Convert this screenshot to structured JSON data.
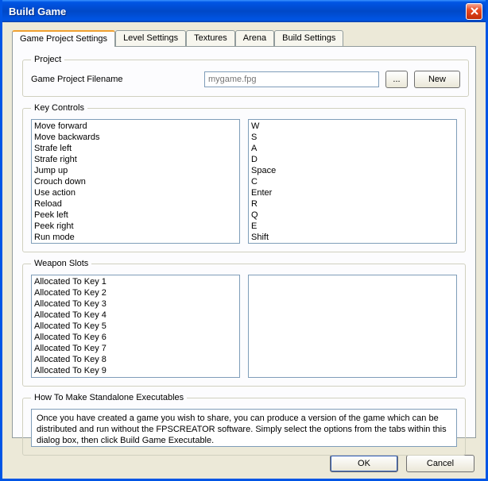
{
  "window": {
    "title": "Build Game"
  },
  "tabs": [
    {
      "label": "Game Project Settings"
    },
    {
      "label": "Level Settings"
    },
    {
      "label": "Textures"
    },
    {
      "label": "Arena"
    },
    {
      "label": "Build Settings"
    }
  ],
  "project": {
    "legend": "Project",
    "label": "Game Project Filename",
    "placeholder": "mygame.fpg",
    "browse": "...",
    "new": "New"
  },
  "key_controls": {
    "legend": "Key Controls",
    "actions": [
      "Move forward",
      "Move backwards",
      "Strafe left",
      "Strafe right",
      "Jump up",
      "Crouch down",
      "Use action",
      "Reload",
      "Peek left",
      "Peek right",
      "Run mode"
    ],
    "keys": [
      "W",
      "S",
      "A",
      "D",
      "Space",
      "C",
      "Enter",
      "R",
      "Q",
      "E",
      "Shift"
    ]
  },
  "weapon_slots": {
    "legend": "Weapon Slots",
    "slots": [
      "Allocated To Key 1",
      "Allocated To Key 2",
      "Allocated To Key 3",
      "Allocated To Key 4",
      "Allocated To Key 5",
      "Allocated To Key 6",
      "Allocated To Key 7",
      "Allocated To Key 8",
      "Allocated To Key 9"
    ]
  },
  "howto": {
    "legend": "How To Make Standalone Executables",
    "text": "Once you have created a game you wish to share, you can produce a version of the game which can be distributed and run without the FPSCREATOR software. Simply select the options from the tabs within this dialog box, then click Build Game Executable."
  },
  "buttons": {
    "ok": "OK",
    "cancel": "Cancel"
  }
}
